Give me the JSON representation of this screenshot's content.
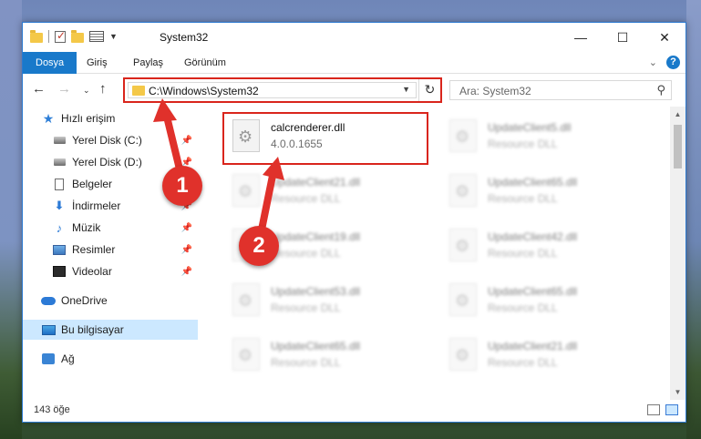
{
  "window": {
    "title": "System32",
    "controls": {
      "minimize": "—",
      "maximize": "☐",
      "close": "✕"
    }
  },
  "ribbon": {
    "tabs": [
      "Dosya",
      "Giriş",
      "Paylaş",
      "Görünüm"
    ]
  },
  "address_bar": {
    "path": "C:\\Windows\\System32",
    "search_placeholder": "Ara: System32"
  },
  "navigation_pane": {
    "items": [
      {
        "label": "Hızlı erişim",
        "icon": "star-icon"
      },
      {
        "label": "Yerel Disk (C:)",
        "icon": "disk-icon",
        "pinned": true
      },
      {
        "label": "Yerel Disk (D:)",
        "icon": "disk-icon",
        "pinned": true
      },
      {
        "label": "Belgeler",
        "icon": "document-icon",
        "pinned": true
      },
      {
        "label": "İndirmeler",
        "icon": "download-icon",
        "pinned": true
      },
      {
        "label": "Müzik",
        "icon": "music-icon",
        "pinned": true
      },
      {
        "label": "Resimler",
        "icon": "picture-icon",
        "pinned": true
      },
      {
        "label": "Videolar",
        "icon": "video-icon",
        "pinned": true
      },
      {
        "label": "OneDrive",
        "icon": "cloud-icon"
      },
      {
        "label": "Bu bilgisayar",
        "icon": "computer-icon",
        "selected": true
      },
      {
        "label": "Ağ",
        "icon": "network-icon"
      }
    ]
  },
  "files": [
    {
      "name": "calcrenderer.dll",
      "type": "4.0.0.1655"
    },
    {
      "name": "UpdateClient5.dll",
      "type": "Resource DLL"
    },
    {
      "name": "UpdateClient21.dll",
      "type": "Resource DLL"
    },
    {
      "name": "UpdateClient65.dll",
      "type": "Resource DLL"
    },
    {
      "name": "UpdateClient19.dll",
      "type": "Resource DLL"
    },
    {
      "name": "UpdateClient42.dll",
      "type": "Resource DLL"
    },
    {
      "name": "UpdateClient53.dll",
      "type": "Resource DLL"
    },
    {
      "name": "UpdateClient65.dll",
      "type": "Resource DLL"
    },
    {
      "name": "UpdateClient65.dll",
      "type": "Resource DLL"
    },
    {
      "name": "UpdateClient21.dll",
      "type": "Resource DLL"
    }
  ],
  "status": {
    "count": "143 öğe"
  },
  "callouts": [
    "1",
    "2"
  ],
  "colors": {
    "accent": "#1979ca",
    "highlight": "#d9251c",
    "callout": "#e0312b",
    "selection": "#cce8ff"
  }
}
